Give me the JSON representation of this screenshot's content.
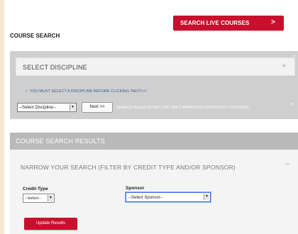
{
  "header": {
    "live_button_label": "SEARCH LIVE COURSES",
    "live_button_arrow": ">",
    "page_title": "COURSE SEARCH"
  },
  "discipline": {
    "title": "SELECT DISCIPLINE",
    "toggle": "+",
    "note": "YOU MUST SELECT A DISCIPLINE BEFORE CLICKING 'NEXT>>'.",
    "select_value": "--Select Discipline--",
    "next_label": "Next >>",
    "info": "SEARCH RESULTS INCLUDE ONLY APPROVED CATEGORY I COURSES."
  },
  "results": {
    "title": "COURSE SEARCH RESULTS",
    "narrow_title": "NARROW YOUR SEARCH (FILTER BY CREDIT TYPE AND/OR SPONSOR)",
    "narrow_toggle": "–",
    "credit_label": "Credit-Type",
    "credit_value": "--Select--",
    "sponsor_label": "Sponsor",
    "sponsor_value": "--Select Sponsor--",
    "update_label": "Update Results"
  },
  "colors": {
    "accent_red": "#c8102e",
    "panel_grey": "#cfcfcf",
    "background": "#f6e6d6"
  }
}
